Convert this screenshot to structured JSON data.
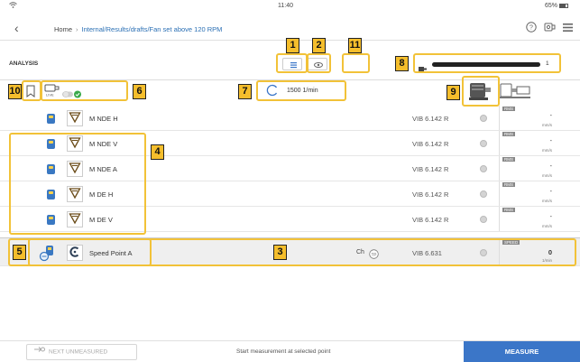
{
  "status_bar": {
    "time": "11:40",
    "battery": "65%"
  },
  "nav": {
    "home": "Home",
    "path": "Internal/Results/drafts/Fan set above 120 RPM",
    "separator": "›"
  },
  "analysis": {
    "title": "ANALYSIS",
    "speed": "1500 1/min",
    "progress": {
      "count": "1",
      "fill_fraction": 1.0
    }
  },
  "callouts": {
    "c1": "1",
    "c2": "2",
    "c3": "3",
    "c4": "4",
    "c5": "5",
    "c6": "6",
    "c7": "7",
    "c8": "8",
    "c9": "9",
    "c10": "10",
    "c11": "11"
  },
  "rows": [
    {
      "name": "M NDE H",
      "model": "VIB 6.142 R",
      "tag": "RMS",
      "value": "-",
      "unit": "mm/s",
      "icon": "triangle-v-icon"
    },
    {
      "name": "M NDE V",
      "model": "VIB 6.142 R",
      "tag": "RMS",
      "value": "-",
      "unit": "mm/s",
      "icon": "triangle-v-icon"
    },
    {
      "name": "M NDE A",
      "model": "VIB 6.142 R",
      "tag": "RMS",
      "value": "-",
      "unit": "mm/s",
      "icon": "triangle-v-icon"
    },
    {
      "name": "M DE H",
      "model": "VIB 6.142 R",
      "tag": "RMS",
      "value": "-",
      "unit": "mm/s",
      "icon": "triangle-v-icon"
    },
    {
      "name": "M DE V",
      "model": "VIB 6.142 R",
      "tag": "RMS",
      "value": "-",
      "unit": "mm/s",
      "icon": "triangle-v-icon"
    }
  ],
  "selected_row": {
    "name": "Speed Point A",
    "channel": "Ch",
    "model": "VIB 6.631",
    "tag": "SPEED",
    "value": "0",
    "unit": "1/min"
  },
  "bottom": {
    "next_label": "NEXT UNMEASURED",
    "instruction": "Start measurement at selected point",
    "measure_label": "MEASURE"
  }
}
